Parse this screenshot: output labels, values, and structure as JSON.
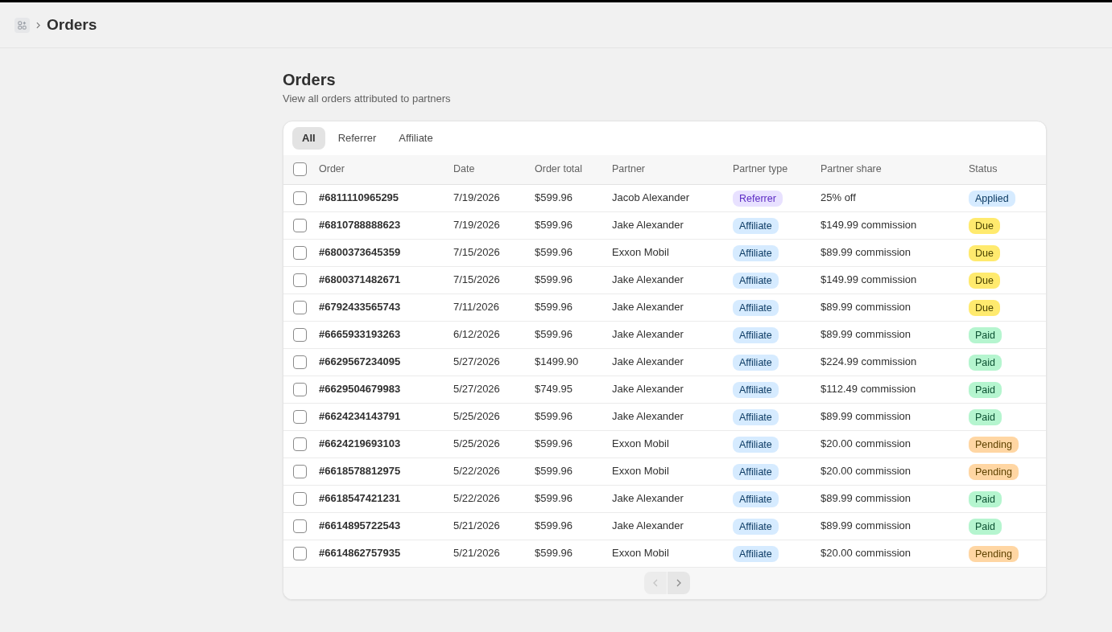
{
  "breadcrumb": {
    "title": "Orders"
  },
  "page": {
    "title": "Orders",
    "subtitle": "View all orders attributed to partners"
  },
  "tabs": [
    {
      "label": "All",
      "selected": true
    },
    {
      "label": "Referrer",
      "selected": false
    },
    {
      "label": "Affiliate",
      "selected": false
    }
  ],
  "table": {
    "select_all": {
      "checked": false
    },
    "columns": [
      "Order",
      "Date",
      "Order total",
      "Partner",
      "Partner type",
      "Partner share",
      "Status"
    ],
    "rows": [
      {
        "checked": false,
        "order": "#6811110965295",
        "date": "7/19/2026",
        "total": "$599.96",
        "partner": "Jacob Alexander",
        "partner_type": {
          "label": "Referrer",
          "kind": "referrer"
        },
        "share": "25% off",
        "status": {
          "label": "Applied",
          "kind": "applied"
        }
      },
      {
        "checked": false,
        "order": "#6810788888623",
        "date": "7/19/2026",
        "total": "$599.96",
        "partner": "Jake Alexander",
        "partner_type": {
          "label": "Affiliate",
          "kind": "affiliate"
        },
        "share": "$149.99 commission",
        "status": {
          "label": "Due",
          "kind": "due"
        }
      },
      {
        "checked": false,
        "order": "#6800373645359",
        "date": "7/15/2026",
        "total": "$599.96",
        "partner": "Exxon Mobil",
        "partner_type": {
          "label": "Affiliate",
          "kind": "affiliate"
        },
        "share": "$89.99 commission",
        "status": {
          "label": "Due",
          "kind": "due"
        }
      },
      {
        "checked": false,
        "order": "#6800371482671",
        "date": "7/15/2026",
        "total": "$599.96",
        "partner": "Jake Alexander",
        "partner_type": {
          "label": "Affiliate",
          "kind": "affiliate"
        },
        "share": "$149.99 commission",
        "status": {
          "label": "Due",
          "kind": "due"
        }
      },
      {
        "checked": false,
        "order": "#6792433565743",
        "date": "7/11/2026",
        "total": "$599.96",
        "partner": "Jake Alexander",
        "partner_type": {
          "label": "Affiliate",
          "kind": "affiliate"
        },
        "share": "$89.99 commission",
        "status": {
          "label": "Due",
          "kind": "due"
        }
      },
      {
        "checked": false,
        "order": "#6665933193263",
        "date": "6/12/2026",
        "total": "$599.96",
        "partner": "Jake Alexander",
        "partner_type": {
          "label": "Affiliate",
          "kind": "affiliate"
        },
        "share": "$89.99 commission",
        "status": {
          "label": "Paid",
          "kind": "paid"
        }
      },
      {
        "checked": false,
        "order": "#6629567234095",
        "date": "5/27/2026",
        "total": "$1499.90",
        "partner": "Jake Alexander",
        "partner_type": {
          "label": "Affiliate",
          "kind": "affiliate"
        },
        "share": "$224.99 commission",
        "status": {
          "label": "Paid",
          "kind": "paid"
        }
      },
      {
        "checked": false,
        "order": "#6629504679983",
        "date": "5/27/2026",
        "total": "$749.95",
        "partner": "Jake Alexander",
        "partner_type": {
          "label": "Affiliate",
          "kind": "affiliate"
        },
        "share": "$112.49 commission",
        "status": {
          "label": "Paid",
          "kind": "paid"
        }
      },
      {
        "checked": false,
        "order": "#6624234143791",
        "date": "5/25/2026",
        "total": "$599.96",
        "partner": "Jake Alexander",
        "partner_type": {
          "label": "Affiliate",
          "kind": "affiliate"
        },
        "share": "$89.99 commission",
        "status": {
          "label": "Paid",
          "kind": "paid"
        }
      },
      {
        "checked": false,
        "order": "#6624219693103",
        "date": "5/25/2026",
        "total": "$599.96",
        "partner": "Exxon Mobil",
        "partner_type": {
          "label": "Affiliate",
          "kind": "affiliate"
        },
        "share": "$20.00 commission",
        "status": {
          "label": "Pending",
          "kind": "pending"
        }
      },
      {
        "checked": false,
        "order": "#6618578812975",
        "date": "5/22/2026",
        "total": "$599.96",
        "partner": "Exxon Mobil",
        "partner_type": {
          "label": "Affiliate",
          "kind": "affiliate"
        },
        "share": "$20.00 commission",
        "status": {
          "label": "Pending",
          "kind": "pending"
        }
      },
      {
        "checked": false,
        "order": "#6618547421231",
        "date": "5/22/2026",
        "total": "$599.96",
        "partner": "Jake Alexander",
        "partner_type": {
          "label": "Affiliate",
          "kind": "affiliate"
        },
        "share": "$89.99 commission",
        "status": {
          "label": "Paid",
          "kind": "paid"
        }
      },
      {
        "checked": false,
        "order": "#6614895722543",
        "date": "5/21/2026",
        "total": "$599.96",
        "partner": "Jake Alexander",
        "partner_type": {
          "label": "Affiliate",
          "kind": "affiliate"
        },
        "share": "$89.99 commission",
        "status": {
          "label": "Paid",
          "kind": "paid"
        }
      },
      {
        "checked": false,
        "order": "#6614862757935",
        "date": "5/21/2026",
        "total": "$599.96",
        "partner": "Exxon Mobil",
        "partner_type": {
          "label": "Affiliate",
          "kind": "affiliate"
        },
        "share": "$20.00 commission",
        "status": {
          "label": "Pending",
          "kind": "pending"
        }
      }
    ]
  },
  "pagination": {
    "previous": {
      "disabled": true
    },
    "next": {
      "disabled": false
    }
  }
}
